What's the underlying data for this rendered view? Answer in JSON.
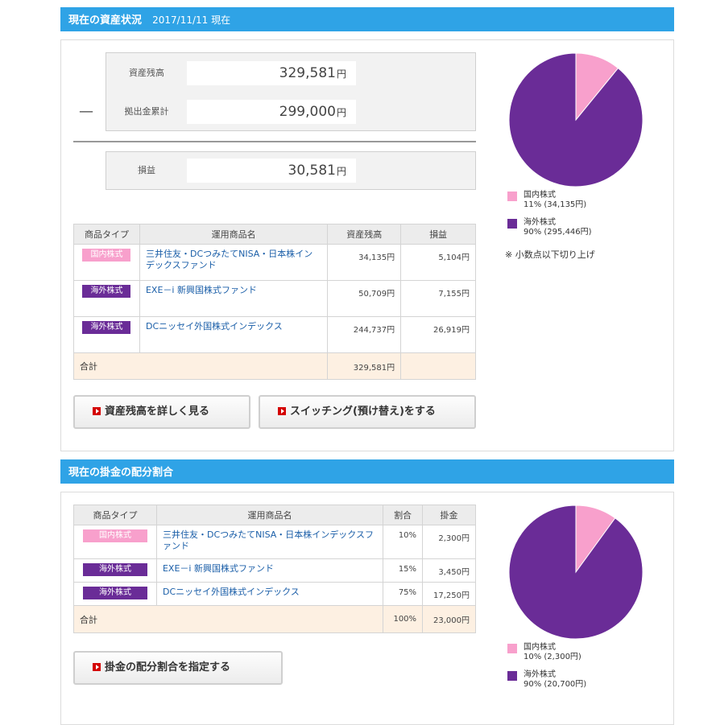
{
  "colors": {
    "header": "#2fa3e6",
    "domestic": "#f8a0cc",
    "foreign": "#6a2c97"
  },
  "assets": {
    "title": "現在の資産状況",
    "date": "2017/11/11 現在",
    "summary": {
      "balance_label": "資産残高",
      "balance_value": "329,581",
      "contribution_label": "拠出金累計",
      "contribution_value": "299,000",
      "profit_label": "損益",
      "profit_value": "30,581",
      "unit": "円",
      "minus": "—"
    },
    "table": {
      "headers": [
        "商品タイプ",
        "運用商品名",
        "資産残高",
        "損益"
      ],
      "rows": [
        {
          "type": "国内株式",
          "name": "三井住友・DCつみたてNISA・日本株インデックスファンド",
          "balance": "34,135円",
          "profit": "5,104円"
        },
        {
          "type": "海外株式",
          "name": "EXE－i 新興国株式ファンド",
          "balance": "50,709円",
          "profit": "7,155円"
        },
        {
          "type": "海外株式",
          "name": "DCニッセイ外国株式インデックス",
          "balance": "244,737円",
          "profit": "26,919円"
        }
      ],
      "total_label": "合計",
      "total_balance": "329,581円"
    },
    "buttons": {
      "detail": "資産残高を詳しく見る",
      "switching": "スイッチング(預け替え)をする"
    },
    "chart_data": {
      "type": "pie",
      "categories": [
        "国内株式",
        "海外株式"
      ],
      "values": [
        11,
        90
      ],
      "amounts": [
        "34,135円",
        "295,446円"
      ],
      "legend": [
        {
          "name": "国内株式",
          "detail": "11% (34,135円)"
        },
        {
          "name": "海外株式",
          "detail": "90% (295,446円)"
        }
      ]
    },
    "note": "※ 小数点以下切り上げ"
  },
  "allocation": {
    "title": "現在の掛金の配分割合",
    "table": {
      "headers": [
        "商品タイプ",
        "運用商品名",
        "割合",
        "掛金"
      ],
      "rows": [
        {
          "type": "国内株式",
          "name": "三井住友・DCつみたてNISA・日本株インデックスファンド",
          "ratio": "10%",
          "amount": "2,300円"
        },
        {
          "type": "海外株式",
          "name": "EXE－i 新興国株式ファンド",
          "ratio": "15%",
          "amount": "3,450円"
        },
        {
          "type": "海外株式",
          "name": "DCニッセイ外国株式インデックス",
          "ratio": "75%",
          "amount": "17,250円"
        }
      ],
      "total_label": "合計",
      "total_ratio": "100%",
      "total_amount": "23,000円"
    },
    "button": "掛金の配分割合を指定する",
    "chart_data": {
      "type": "pie",
      "categories": [
        "国内株式",
        "海外株式"
      ],
      "values": [
        10,
        90
      ],
      "amounts": [
        "2,300円",
        "20,700円"
      ],
      "legend": [
        {
          "name": "国内株式",
          "detail": "10% (2,300円)"
        },
        {
          "name": "海外株式",
          "detail": "90% (20,700円)"
        }
      ]
    }
  }
}
